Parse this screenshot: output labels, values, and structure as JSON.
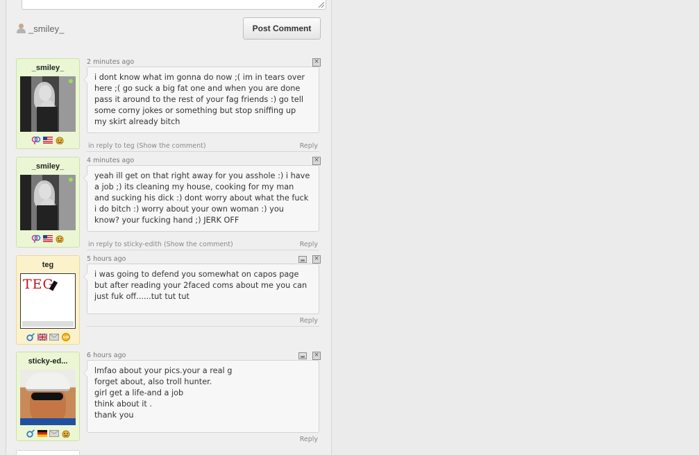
{
  "composer": {
    "username": "_smiley_",
    "post_button": "Post Comment"
  },
  "comments": [
    {
      "user": "_smiley_",
      "time": "2 minutes ago",
      "lines": [
        "i dont know what im gonna do now ;( im in tears over",
        "here ;( go suck a big fat one and when you are done",
        "pass it around to the rest of your fag friends :) go tell",
        "some corny jokes or something but stop sniffing up",
        "my skirt already bitch"
      ],
      "reply_context": "in reply to teg (Show the comment)",
      "reply_label": "Reply"
    },
    {
      "user": "_smiley_",
      "time": "4 minutes ago",
      "lines": [
        "yeah ill get on that right away for you asshole :) i have",
        "a job ;) its cleaning my house, cooking for my man",
        "and sucking his dick :) dont worry about what the fuck",
        "i do bitch :) worry about your own woman :) you",
        "know? your fucking hand ;) JERK OFF"
      ],
      "reply_context": "in reply to sticky-edith (Show the comment)",
      "reply_label": "Reply"
    },
    {
      "user": "teg",
      "time": "5 hours ago",
      "avatar_text": "TEG",
      "lines": [
        "i was going to defend you somewhat on capos page",
        "but after reading your 2faced coms about me you can",
        "just fuk off......tut tut tut"
      ],
      "reply_label": "Reply"
    },
    {
      "user": "sticky-ed...",
      "time": "6 hours ago",
      "lines": [
        "lmfao about your pics.your a real g",
        "forget about, also troll hunter.",
        "girl get a life-and a job",
        "think about it .",
        "thank you"
      ],
      "reply_label": "Reply"
    }
  ],
  "icons": {
    "female_male": "gender-icon",
    "flag_us": "us-flag-icon",
    "flag_uk": "uk-flag-icon",
    "flag_de": "germany-flag-icon",
    "message": "envelope-icon",
    "mood": "smiley-cat-icon",
    "vip": "vip-badge-icon"
  },
  "colors": {
    "card_green": "#ebf6d4",
    "card_yellow": "#fbf2cc"
  }
}
